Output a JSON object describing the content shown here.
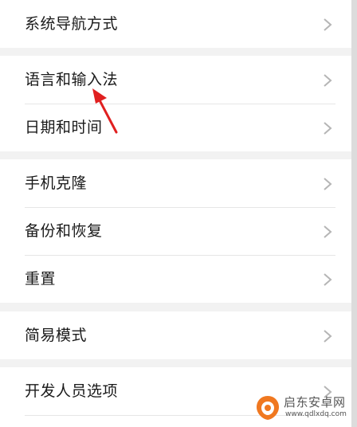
{
  "settings": {
    "items": [
      {
        "label": "系统导航方式"
      },
      {
        "label": "语言和输入法"
      },
      {
        "label": "日期和时间"
      },
      {
        "label": "手机克隆"
      },
      {
        "label": "备份和恢复"
      },
      {
        "label": "重置"
      },
      {
        "label": "简易模式"
      },
      {
        "label": "开发人员选项"
      }
    ]
  },
  "watermark": {
    "name": "启东安卓网",
    "url": "www.qdlxdq.com"
  },
  "colors": {
    "background": "#f2f2f2",
    "card": "#ffffff",
    "text": "#1a1a1a",
    "chevron": "#b5b5b5",
    "annotation_arrow": "#e02020",
    "logo_orange": "#f07820"
  },
  "icons": {
    "chevron": "chevron-right-icon",
    "annotation": "red-arrow-annotation",
    "logo": "qdlxdq-logo"
  }
}
